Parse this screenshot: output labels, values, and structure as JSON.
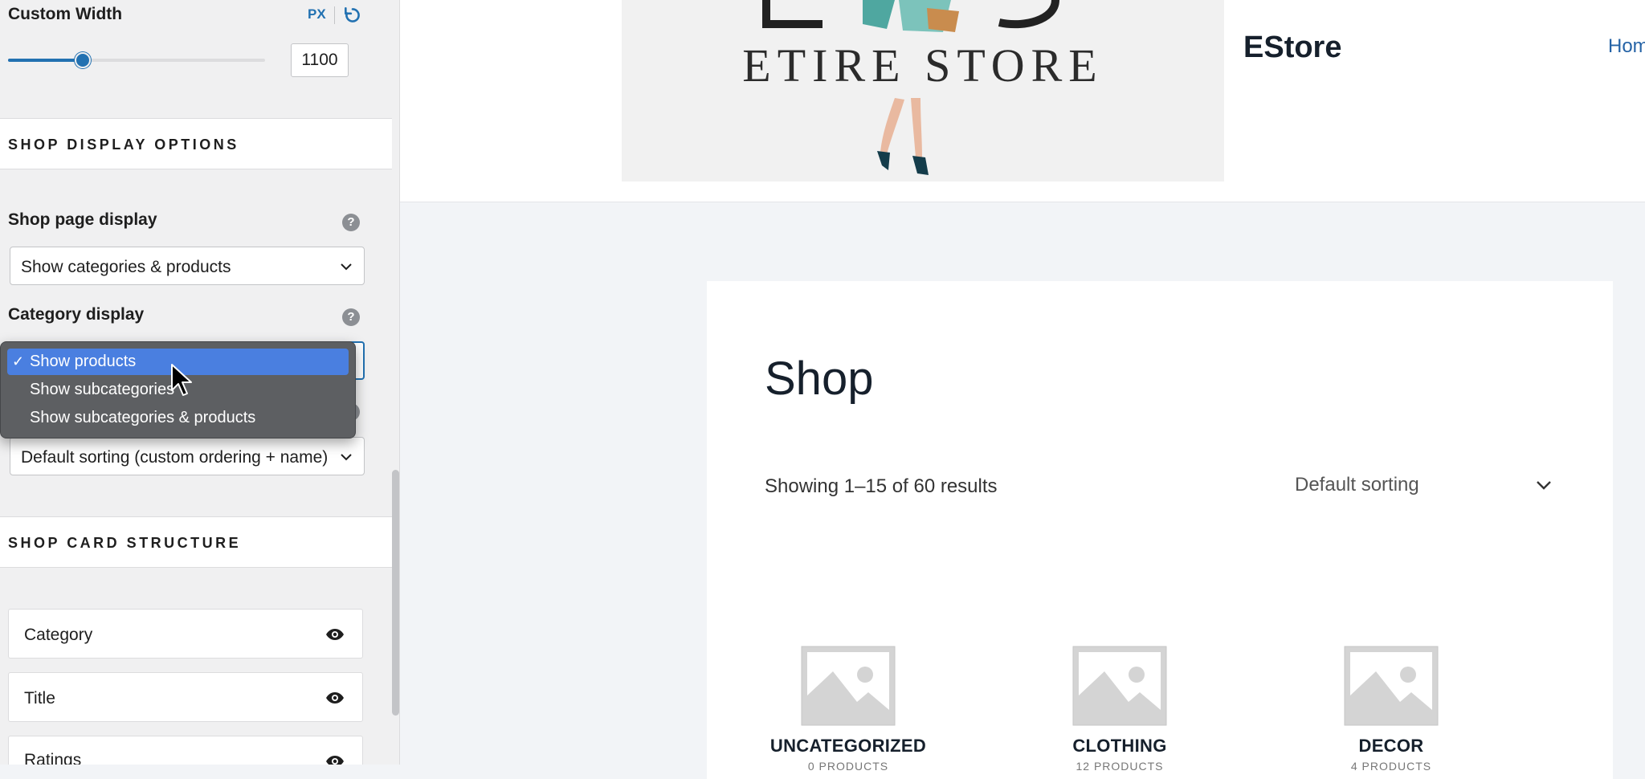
{
  "sidebar": {
    "custom_width": {
      "label": "Custom Width",
      "unit": "PX",
      "value": "1100",
      "slider_fraction": 0.29
    },
    "shop_display_section": "SHOP DISPLAY OPTIONS",
    "shop_page_display": {
      "label": "Shop page display",
      "help": "?",
      "value": "Show categories & products"
    },
    "category_display": {
      "label": "Category display",
      "help": "?",
      "options": [
        {
          "check": "✓",
          "label": "Show products"
        },
        {
          "label": "Show subcategories"
        },
        {
          "label": "Show subcategories & products"
        }
      ]
    },
    "default_sorting": {
      "help": "?",
      "value": "Default sorting (custom ordering + name)"
    },
    "card_structure_section": "SHOP CARD STRUCTURE",
    "card_items": [
      "Category",
      "Title",
      "Ratings"
    ]
  },
  "preview": {
    "logo_text": "ETIRE STORE",
    "site_title": "EStore",
    "nav_link": "Home",
    "shop_title": "Shop",
    "results": "Showing 1–15 of 60 results",
    "sort_label": "Default sorting",
    "categories": [
      {
        "name": "UNCATEGORIZED",
        "count": "0 PRODUCTS"
      },
      {
        "name": "CLOTHING",
        "count": "12 PRODUCTS"
      },
      {
        "name": "DECOR",
        "count": "4 PRODUCTS"
      }
    ]
  },
  "colors": {
    "accent": "#2271b1",
    "dropdown_bg": "#5d5f62",
    "dropdown_selected": "#4a7fe0"
  }
}
